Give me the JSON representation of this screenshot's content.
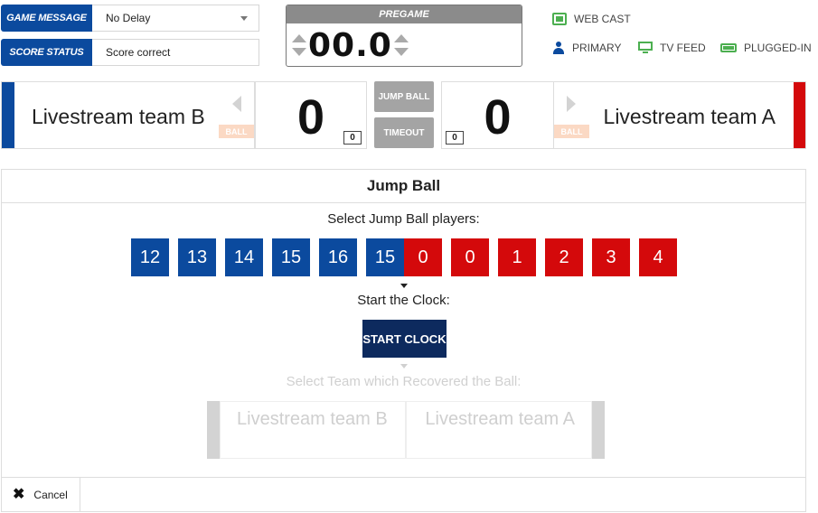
{
  "controls": {
    "game_message_label": "GAME MESSAGE",
    "game_message_value": "No Delay",
    "score_status_label": "SCORE STATUS",
    "score_status_value": "Score correct"
  },
  "clock": {
    "period_label": "PREGAME",
    "time": "00.0"
  },
  "status": {
    "webcast": "WEB CAST",
    "primary": "PRIMARY",
    "tv_feed": "TV FEED",
    "plugged_in": "PLUGGED-IN"
  },
  "scoreboard": {
    "team_b": {
      "name": "Livestream team B",
      "score": "0",
      "fouls": "0",
      "ball_label": "BALL",
      "color": "#0b4a9e"
    },
    "team_a": {
      "name": "Livestream team A",
      "score": "0",
      "fouls": "0",
      "ball_label": "BALL",
      "color": "#d4090b"
    },
    "jump_ball_label": "JUMP BALL",
    "timeout_label": "TIMEOUT"
  },
  "jump_ball": {
    "title": "Jump Ball",
    "select_players_prompt": "Select Jump Ball players:",
    "team_b_players": [
      "12",
      "13",
      "14",
      "15",
      "16",
      "15"
    ],
    "team_a_players": [
      "0",
      "0",
      "1",
      "2",
      "3",
      "4"
    ],
    "start_clock_prompt": "Start the Clock:",
    "start_clock_label": "START CLOCK",
    "recover_prompt": "Select Team which Recovered the Ball:",
    "recover_team_b": "Livestream team B",
    "recover_team_a": "Livestream team A",
    "cancel_label": "Cancel"
  }
}
